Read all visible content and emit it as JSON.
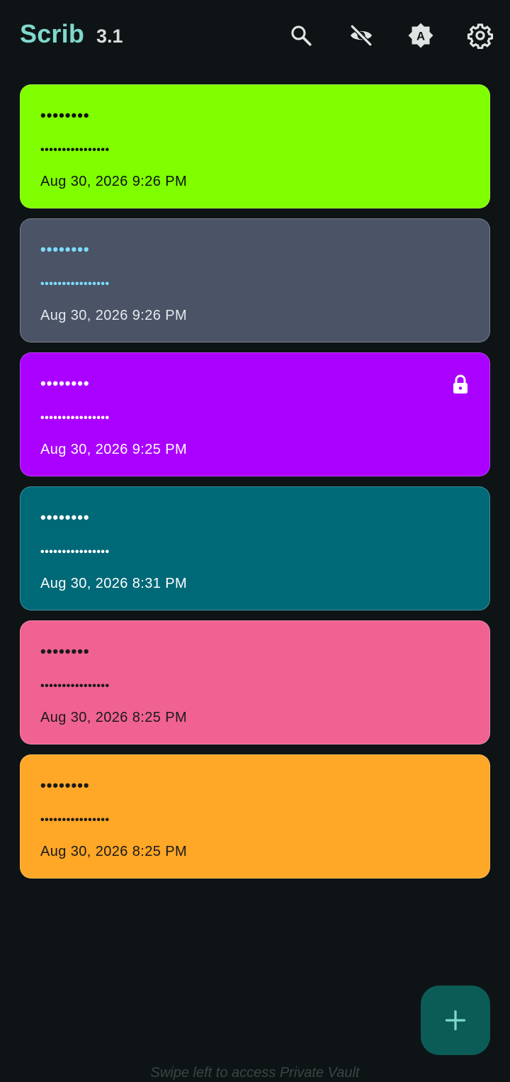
{
  "header": {
    "title": "Scrib",
    "version": "3.1",
    "icons": [
      "search-icon",
      "visibility-off-icon",
      "auto-brightness-icon",
      "gear-icon"
    ]
  },
  "notes": [
    {
      "title": "••••••••",
      "body": "••••••••••••••••",
      "date": "Aug 30, 2026 9:26 PM",
      "bg": "#7fff00",
      "text": "#111111",
      "locked": false
    },
    {
      "title": "••••••••",
      "body": "••••••••••••••••",
      "date": "Aug 30, 2026 9:26 PM",
      "bg": "#4a5466",
      "text": "#7fdcff",
      "date_color": "#e6e9ee",
      "locked": false
    },
    {
      "title": "••••••••",
      "body": "••••••••••••••••",
      "date": "Aug 30, 2026 9:25 PM",
      "bg": "#aa00ff",
      "text": "#ffffff",
      "locked": true
    },
    {
      "title": "••••••••",
      "body": "••••••••••••••••",
      "date": "Aug 30, 2026 8:31 PM",
      "bg": "#006978",
      "text": "#ffffff",
      "locked": false
    },
    {
      "title": "••••••••",
      "body": "••••••••••••••••",
      "date": "Aug 30, 2026 8:25 PM",
      "bg": "#f06292",
      "text": "#1a1a1a",
      "locked": false
    },
    {
      "title": "••••••••",
      "body": "••••••••••••••••",
      "date": "Aug 30, 2026 8:25 PM",
      "bg": "#ffa726",
      "text": "#1a1a1a",
      "locked": false
    }
  ],
  "fab": {
    "icon": "plus-icon",
    "color": "#80d8cc"
  },
  "footer_hint": "Swipe left to access Private Vault"
}
